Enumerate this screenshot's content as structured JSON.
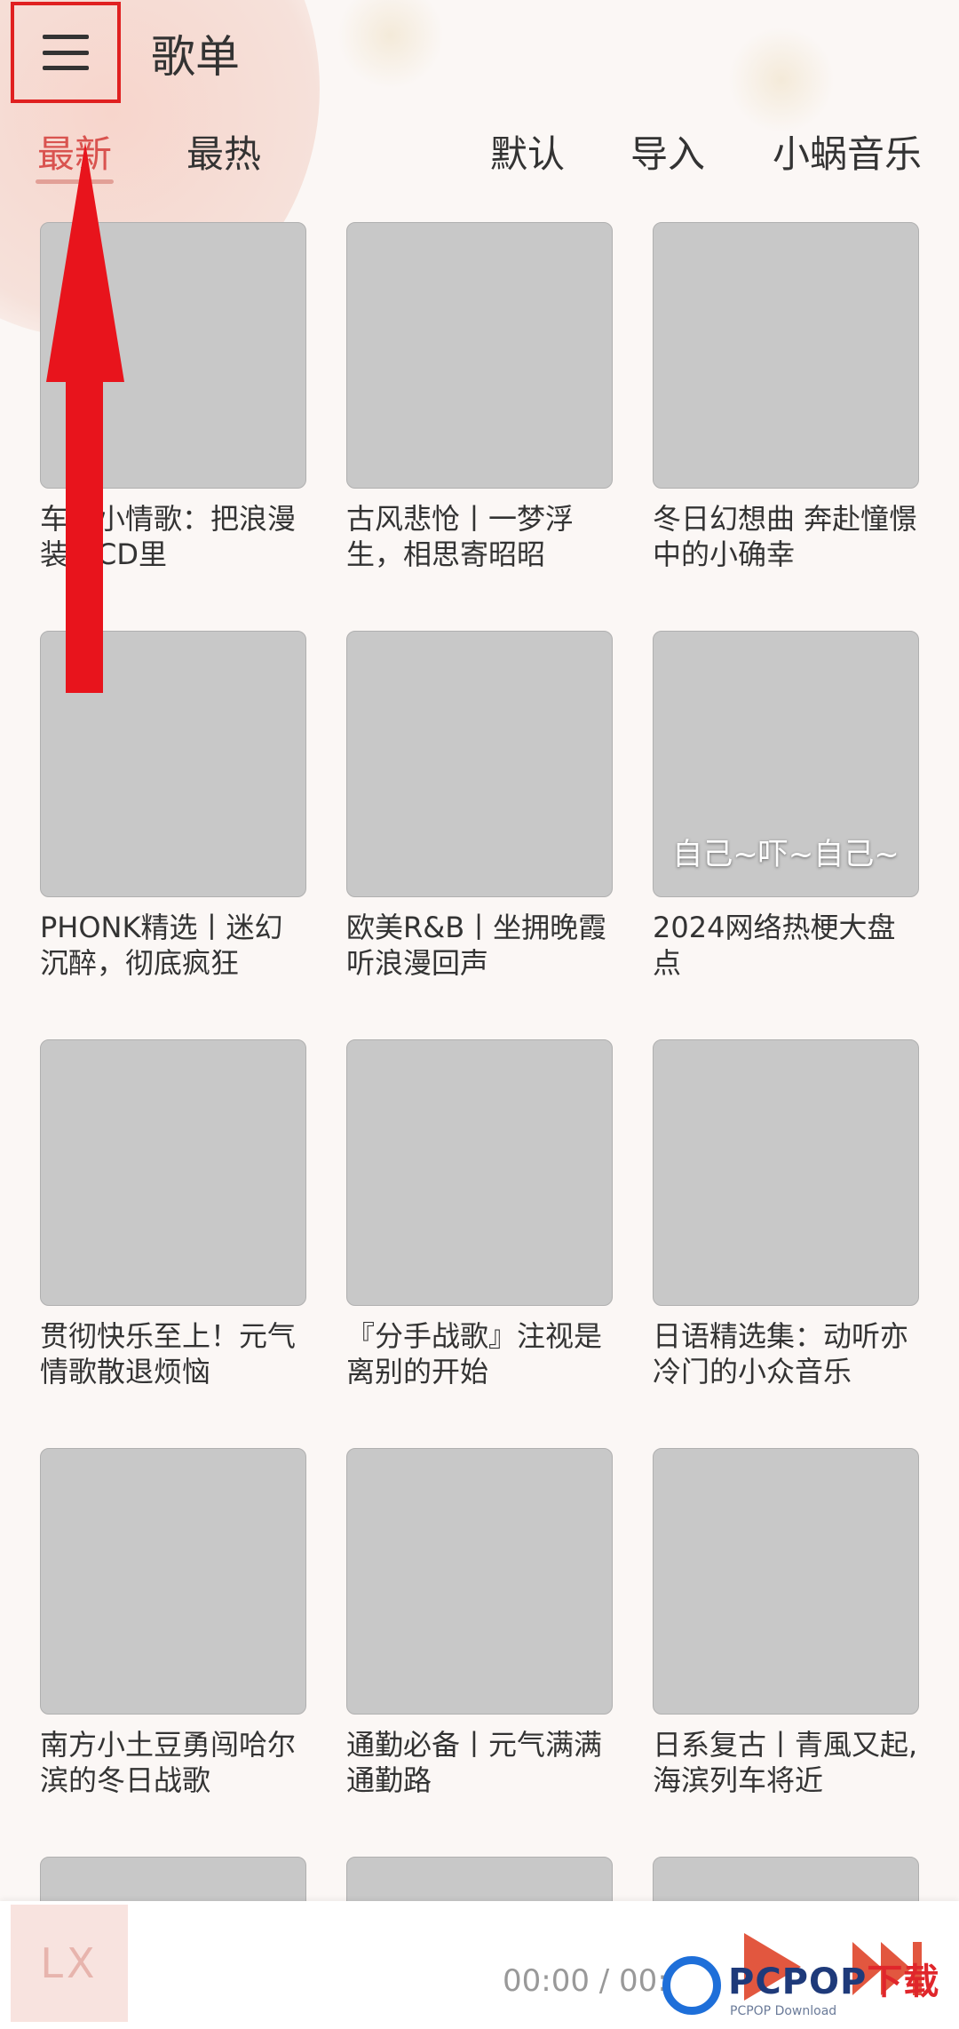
{
  "header": {
    "title": "歌单",
    "menu_icon": "hamburger-menu-icon"
  },
  "tabs": {
    "latest": "最新",
    "hottest": "最热",
    "default": "默认",
    "import": "导入",
    "source": "小蜗音乐"
  },
  "playlists": [
    {
      "title": "车…小情歌：把浪漫装…CD里",
      "caption": ""
    },
    {
      "title": "古风悲怆丨一梦浮生，相思寄昭昭",
      "caption": ""
    },
    {
      "title": "冬日幻想曲 奔赴憧憬中的小确幸",
      "caption": ""
    },
    {
      "title": "PHONK精选丨迷幻沉醉，彻底疯狂",
      "caption": ""
    },
    {
      "title": "欧美R&B丨坐拥晚霞听浪漫回声",
      "caption": ""
    },
    {
      "title": "2024网络热梗大盘点",
      "caption": "自己~吓~自己~"
    },
    {
      "title": "贯彻快乐至上！元气情歌散退烦恼",
      "caption": ""
    },
    {
      "title": "『分手战歌』注视是离别的开始",
      "caption": ""
    },
    {
      "title": "日语精选集：动听亦冷门的小众音乐",
      "caption": ""
    },
    {
      "title": "南方小土豆勇闯哈尔滨的冬日战歌",
      "caption": ""
    },
    {
      "title": "通勤必备丨元气满满通勤路",
      "caption": ""
    },
    {
      "title": "日系复古丨青風又起,海滨列车将近",
      "caption": ""
    }
  ],
  "player": {
    "thumb_label": "LX",
    "time": "00:00 / 00:0",
    "play_icon": "play-icon",
    "next_icon": "next-track-icon"
  },
  "watermark": {
    "brand": "PCPOP",
    "brand_accent": "下载",
    "sub": "PCPOP Download"
  },
  "colors": {
    "accent": "#d9534f",
    "annotation_red": "#e8141c",
    "player_accent": "#e2573f"
  }
}
